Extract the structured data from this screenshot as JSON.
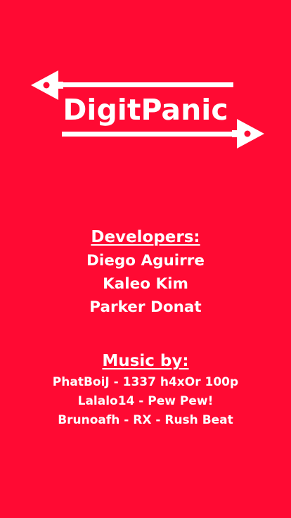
{
  "logo": {
    "title": "DigitPanic"
  },
  "developers": {
    "heading": "Developers:",
    "names": [
      "Diego Aguirre",
      "Kaleo Kim",
      "Parker Donat"
    ]
  },
  "music": {
    "heading": "Music by:",
    "tracks": [
      "PhatBoiJ - 1337 h4xOr 100p",
      "Lalalo14 - Pew Pew!",
      "Brunoafh - RX - Rush Beat"
    ]
  },
  "colors": {
    "background": "#ff0a33",
    "text": "#ffffff"
  }
}
